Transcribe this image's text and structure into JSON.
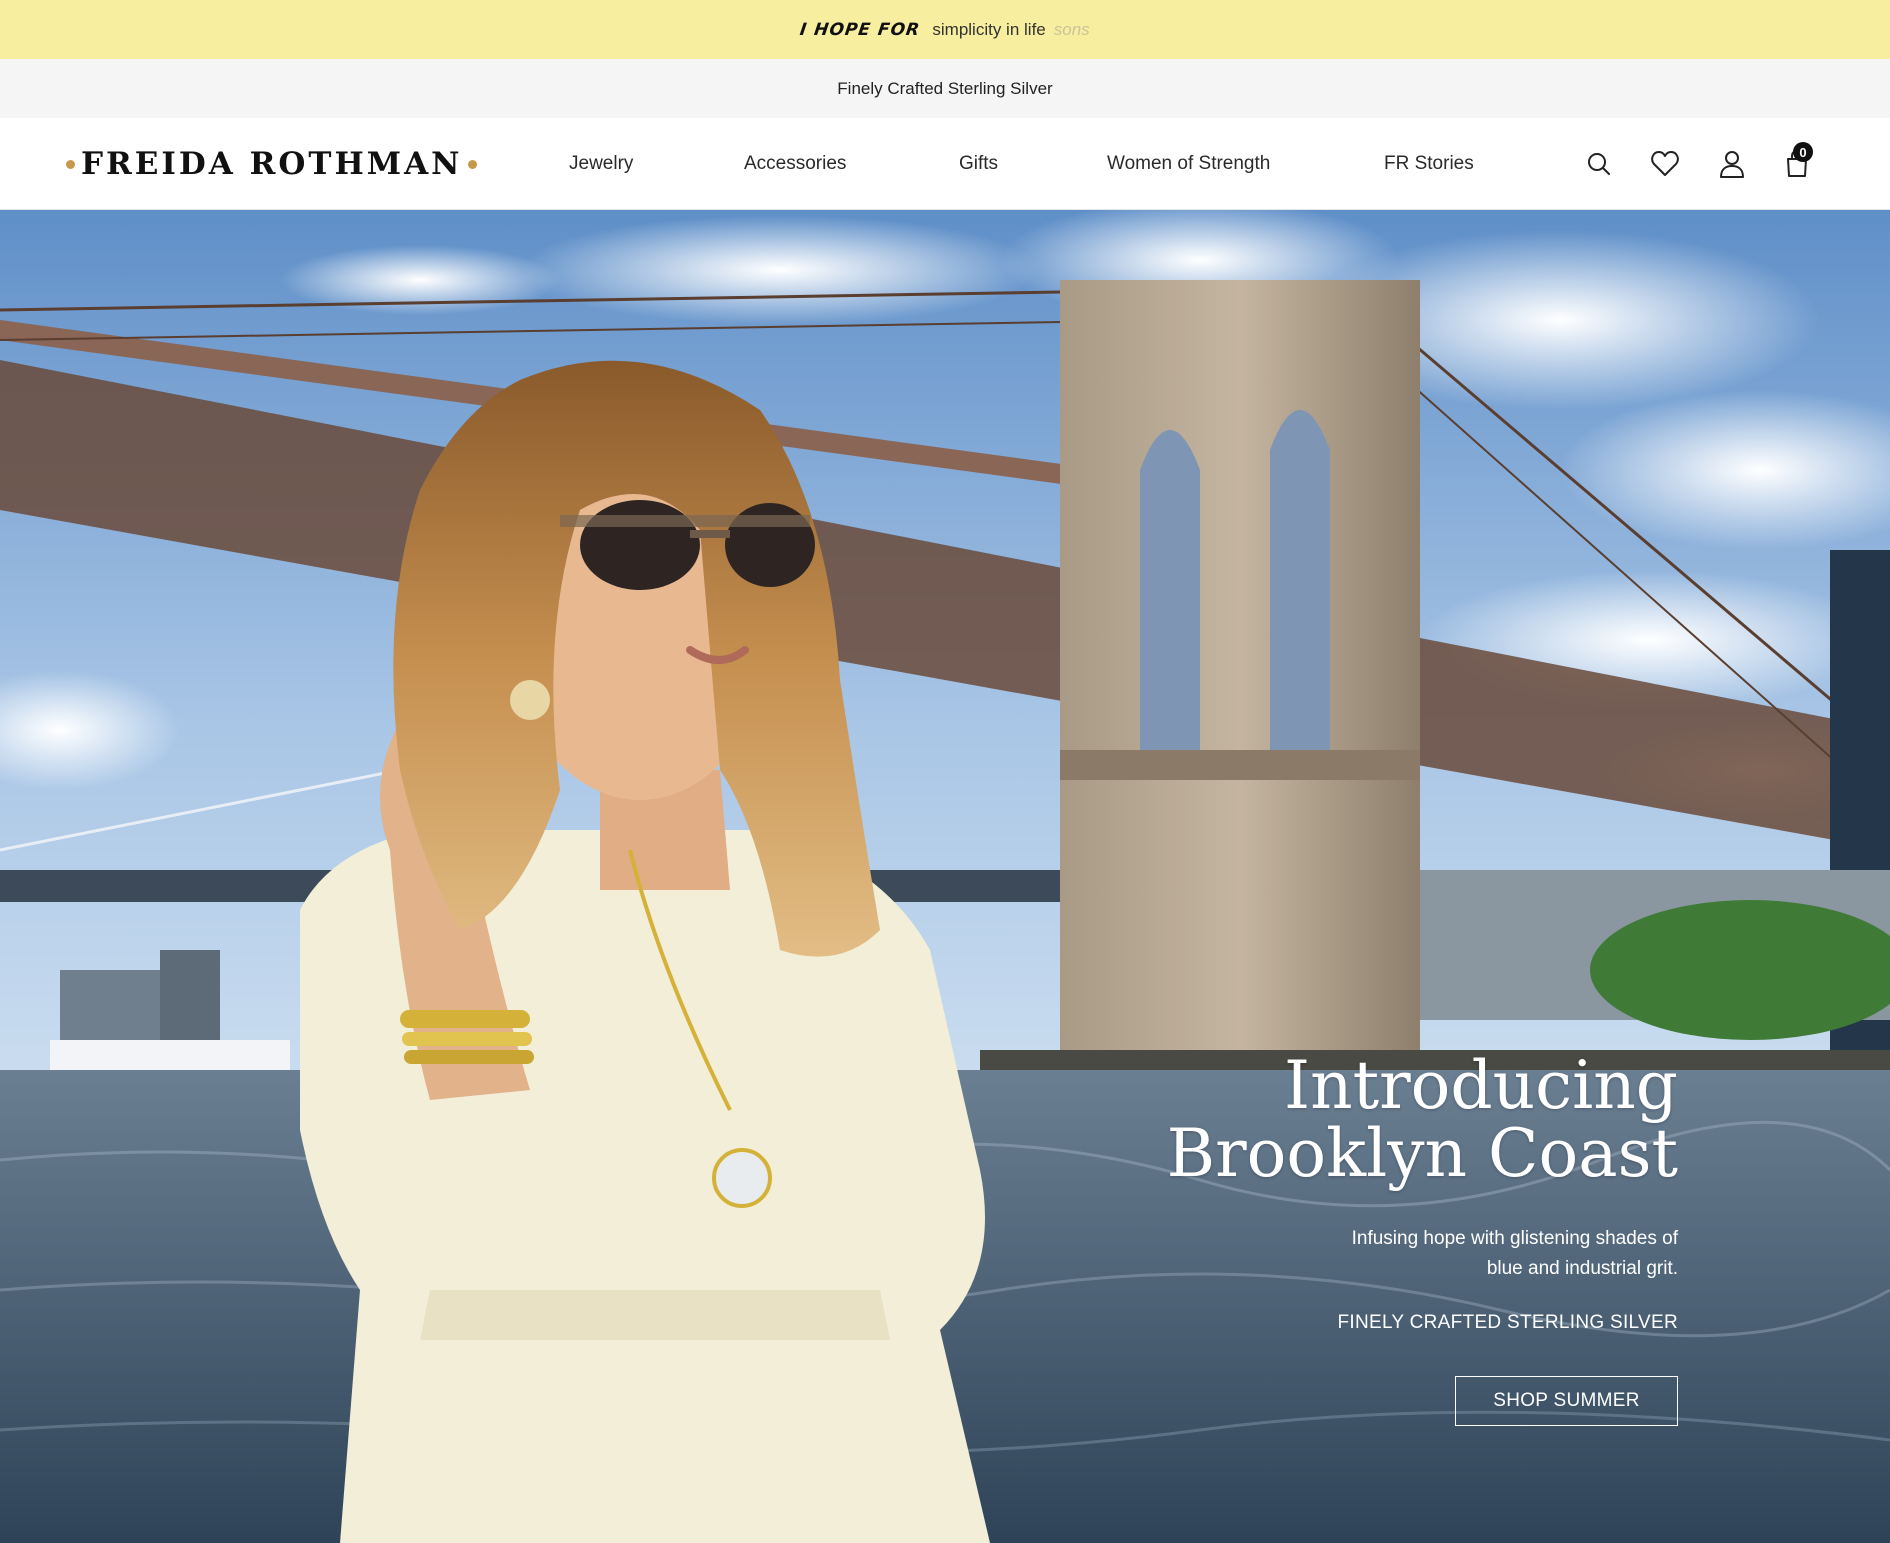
{
  "promo": {
    "script_text": "I HOPE FOR",
    "message": "simplicity in life",
    "ghost": "sons"
  },
  "subbar": {
    "text": "Finely Crafted Sterling Silver"
  },
  "header": {
    "logo": "FREIDA ROTHMAN",
    "nav": [
      "Jewelry",
      "Accessories",
      "Gifts",
      "Women of Strength",
      "FR Stories"
    ],
    "icons": [
      "search-icon",
      "heart-icon",
      "user-icon",
      "bag-icon"
    ],
    "cart_count": "0",
    "accent_color": "#c49a4a"
  },
  "hero": {
    "title_line1": "Introducing",
    "title_line2": "Brooklyn Coast",
    "subtitle": "Infusing hope with glistening shades of blue and industrial grit.",
    "tagline": "FINELY CRAFTED STERLING SILVER",
    "cta": "SHOP SUMMER"
  }
}
